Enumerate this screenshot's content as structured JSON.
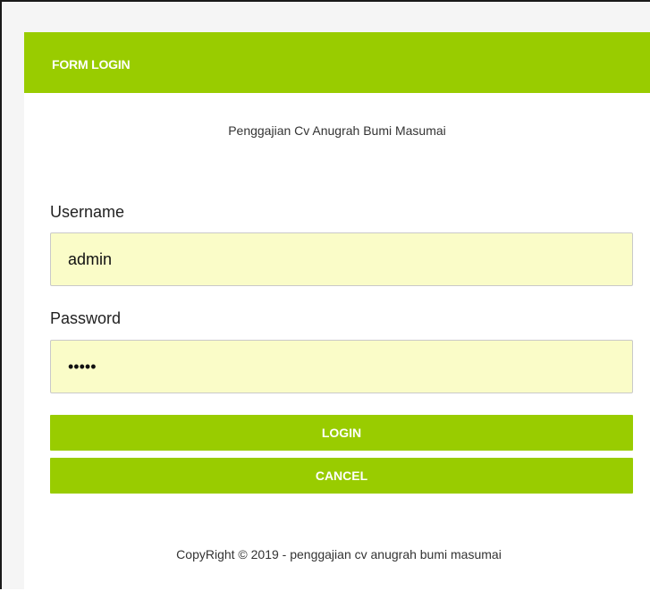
{
  "form": {
    "header_title": "FORM LOGIN",
    "subtitle": "Penggajian Cv Anugrah Bumi Masumai",
    "username_label": "Username",
    "username_value": "admin",
    "password_label": "Password",
    "password_value": "admin",
    "login_label": "LOGIN",
    "cancel_label": "CANCEL"
  },
  "footer": {
    "text": "CopyRight © 2019 - penggajian cv anugrah bumi masumai"
  },
  "colors": {
    "accent": "#99cc00",
    "input_bg": "#fafcc8"
  }
}
